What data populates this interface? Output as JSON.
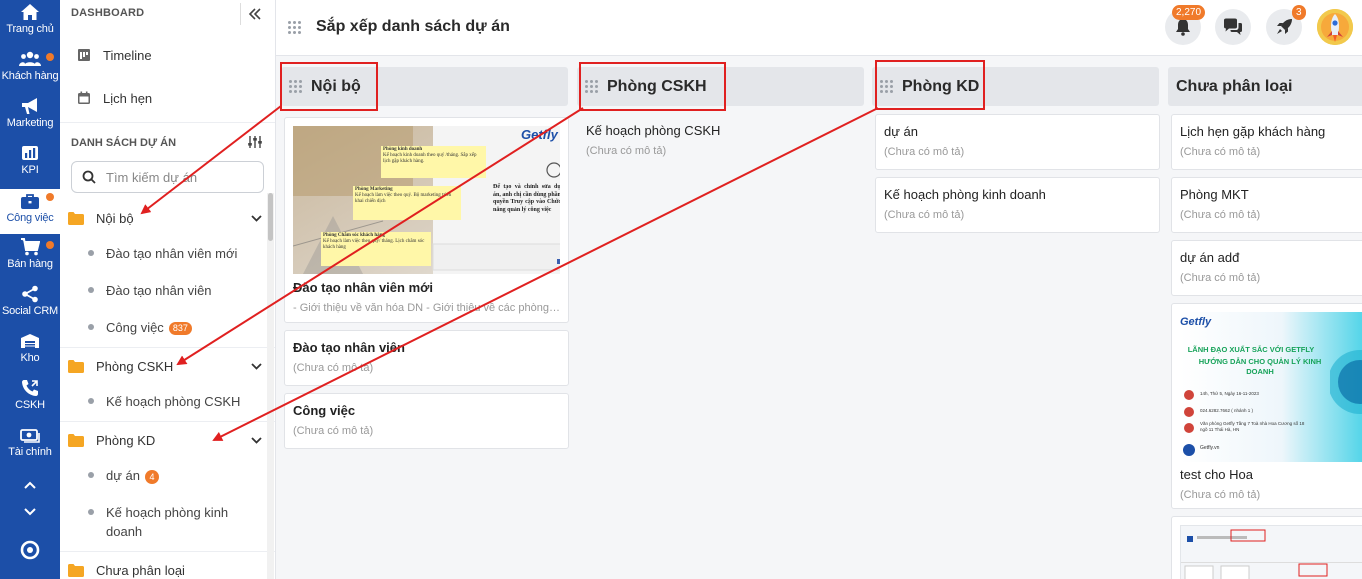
{
  "rail": {
    "items": [
      {
        "label": "Trang chủ",
        "icon": "home-icon"
      },
      {
        "label": "Khách hàng",
        "icon": "users-icon",
        "dot": true
      },
      {
        "label": "Marketing",
        "icon": "megaphone-icon"
      },
      {
        "label": "KPI",
        "icon": "kpi-chart-icon"
      },
      {
        "label": "Công việc",
        "icon": "briefcase-icon",
        "dot": true,
        "active": true
      },
      {
        "label": "Bán hàng",
        "icon": "cart-icon",
        "dot": true
      },
      {
        "label": "Social CRM",
        "icon": "share-icon"
      },
      {
        "label": "Kho",
        "icon": "warehouse-icon"
      },
      {
        "label": "CSKH",
        "icon": "phone-icon"
      },
      {
        "label": "Tài chính",
        "icon": "money-icon"
      }
    ]
  },
  "sidebar": {
    "dashboard_label": "DASHBOARD",
    "links": {
      "timeline": "Timeline",
      "calendar": "Lịch hẹn"
    },
    "projects_label": "DANH SÁCH DỰ ÁN",
    "search_placeholder": "Tìm kiếm dự án",
    "groups": [
      {
        "name": "Nội bộ",
        "subs": [
          {
            "label": "Đào tạo nhân viên mới"
          },
          {
            "label": "Đào tạo nhân viên"
          },
          {
            "label": "Công việc",
            "badge": "837"
          }
        ]
      },
      {
        "name": "Phòng CSKH",
        "subs": [
          {
            "label": "Kế hoạch phòng CSKH"
          }
        ]
      },
      {
        "name": "Phòng KD",
        "subs": [
          {
            "label": "dự án",
            "badge": "4"
          },
          {
            "label": "Kế hoạch phòng kinh doanh"
          }
        ]
      },
      {
        "name": "Chưa phân loại"
      }
    ]
  },
  "header": {
    "title": "Sắp xếp danh sách dự án",
    "notif_badge": "2,270",
    "rocket_badge": "3"
  },
  "columns": [
    {
      "title": "Nội bộ",
      "cards": [
        {
          "title": "Đào tạo nhân viên mới",
          "desc": "- Giới thiệu về văn hóa DN - Giới thiệu về các phòng ban...",
          "cover": "getfly-workspace"
        },
        {
          "title": "Đào tạo nhân viên",
          "desc": "(Chưa có mô tả)"
        },
        {
          "title": "Công việc",
          "desc": "(Chưa có mô tả)"
        }
      ]
    },
    {
      "title": "Phòng CSKH",
      "cards": [
        {
          "title": "Kế hoạch phòng CSKH",
          "desc": "(Chưa có mô tả)"
        }
      ]
    },
    {
      "title": "Phòng KD",
      "cards": [
        {
          "title": "dự án",
          "desc": "(Chưa có mô tả)"
        },
        {
          "title": "Kế hoạch phòng kinh doanh",
          "desc": "(Chưa có mô tả)"
        }
      ]
    },
    {
      "title": "Chưa phân loại",
      "cards": [
        {
          "title": "Lịch hẹn gặp khách hàng",
          "desc": "(Chưa có mô tả)"
        },
        {
          "title": "Phòng MKT",
          "desc": "(Chưa có mô tả)"
        },
        {
          "title": "dự án adđ",
          "desc": "(Chưa có mô tả)"
        },
        {
          "title": "test cho Hoa",
          "desc": "(Chưa có mô tả)",
          "cover": "getfly-event"
        }
      ]
    }
  ],
  "cover_texts": {
    "getfly_logo": "Getfly",
    "note1_title": "Phòng kinh doanh",
    "note1_body": "Kế hoạch kinh doanh theo quý /tháng. Sắp xếp lịch gặp khách hàng.",
    "note2_title": "Phòng Marketing",
    "note2_body": "Kế hoạch làm việc theo quý. Bộ marketing triển khai chiến dịch",
    "note3_title": "Phòng Chăm sóc khách hàng",
    "note3_body": "Kế hoạch làm việc theo quý/ tháng. Lịch chăm sóc khách hàng",
    "side_text": "Để tạo và chỉnh sửa dự án, anh chị cần dùng phần quyền Truy cập vào Chức năng quản lý công việc",
    "event_headline": "LÃNH ĐẠO XUẤT SẮC VỚI GETFLY",
    "event_sub": "HƯỚNG DẪN CHO QUẢN LÝ KINH DOANH",
    "event_date": "14h, Thứ 5, Ngày 16-11-2023",
    "event_phone": "024.6282.7662 ( nhánh 1 )",
    "event_addr": "Văn phòng Getfly Tầng 7 Toà nhà Hoa Cương số 18 ngõ 11 Thái Hà, HN",
    "event_web": "Getfly.vn"
  },
  "colors": {
    "rail_bg": "#1c4fa8",
    "accent_orange": "#f07a2a",
    "annotation_red": "#e02020"
  }
}
